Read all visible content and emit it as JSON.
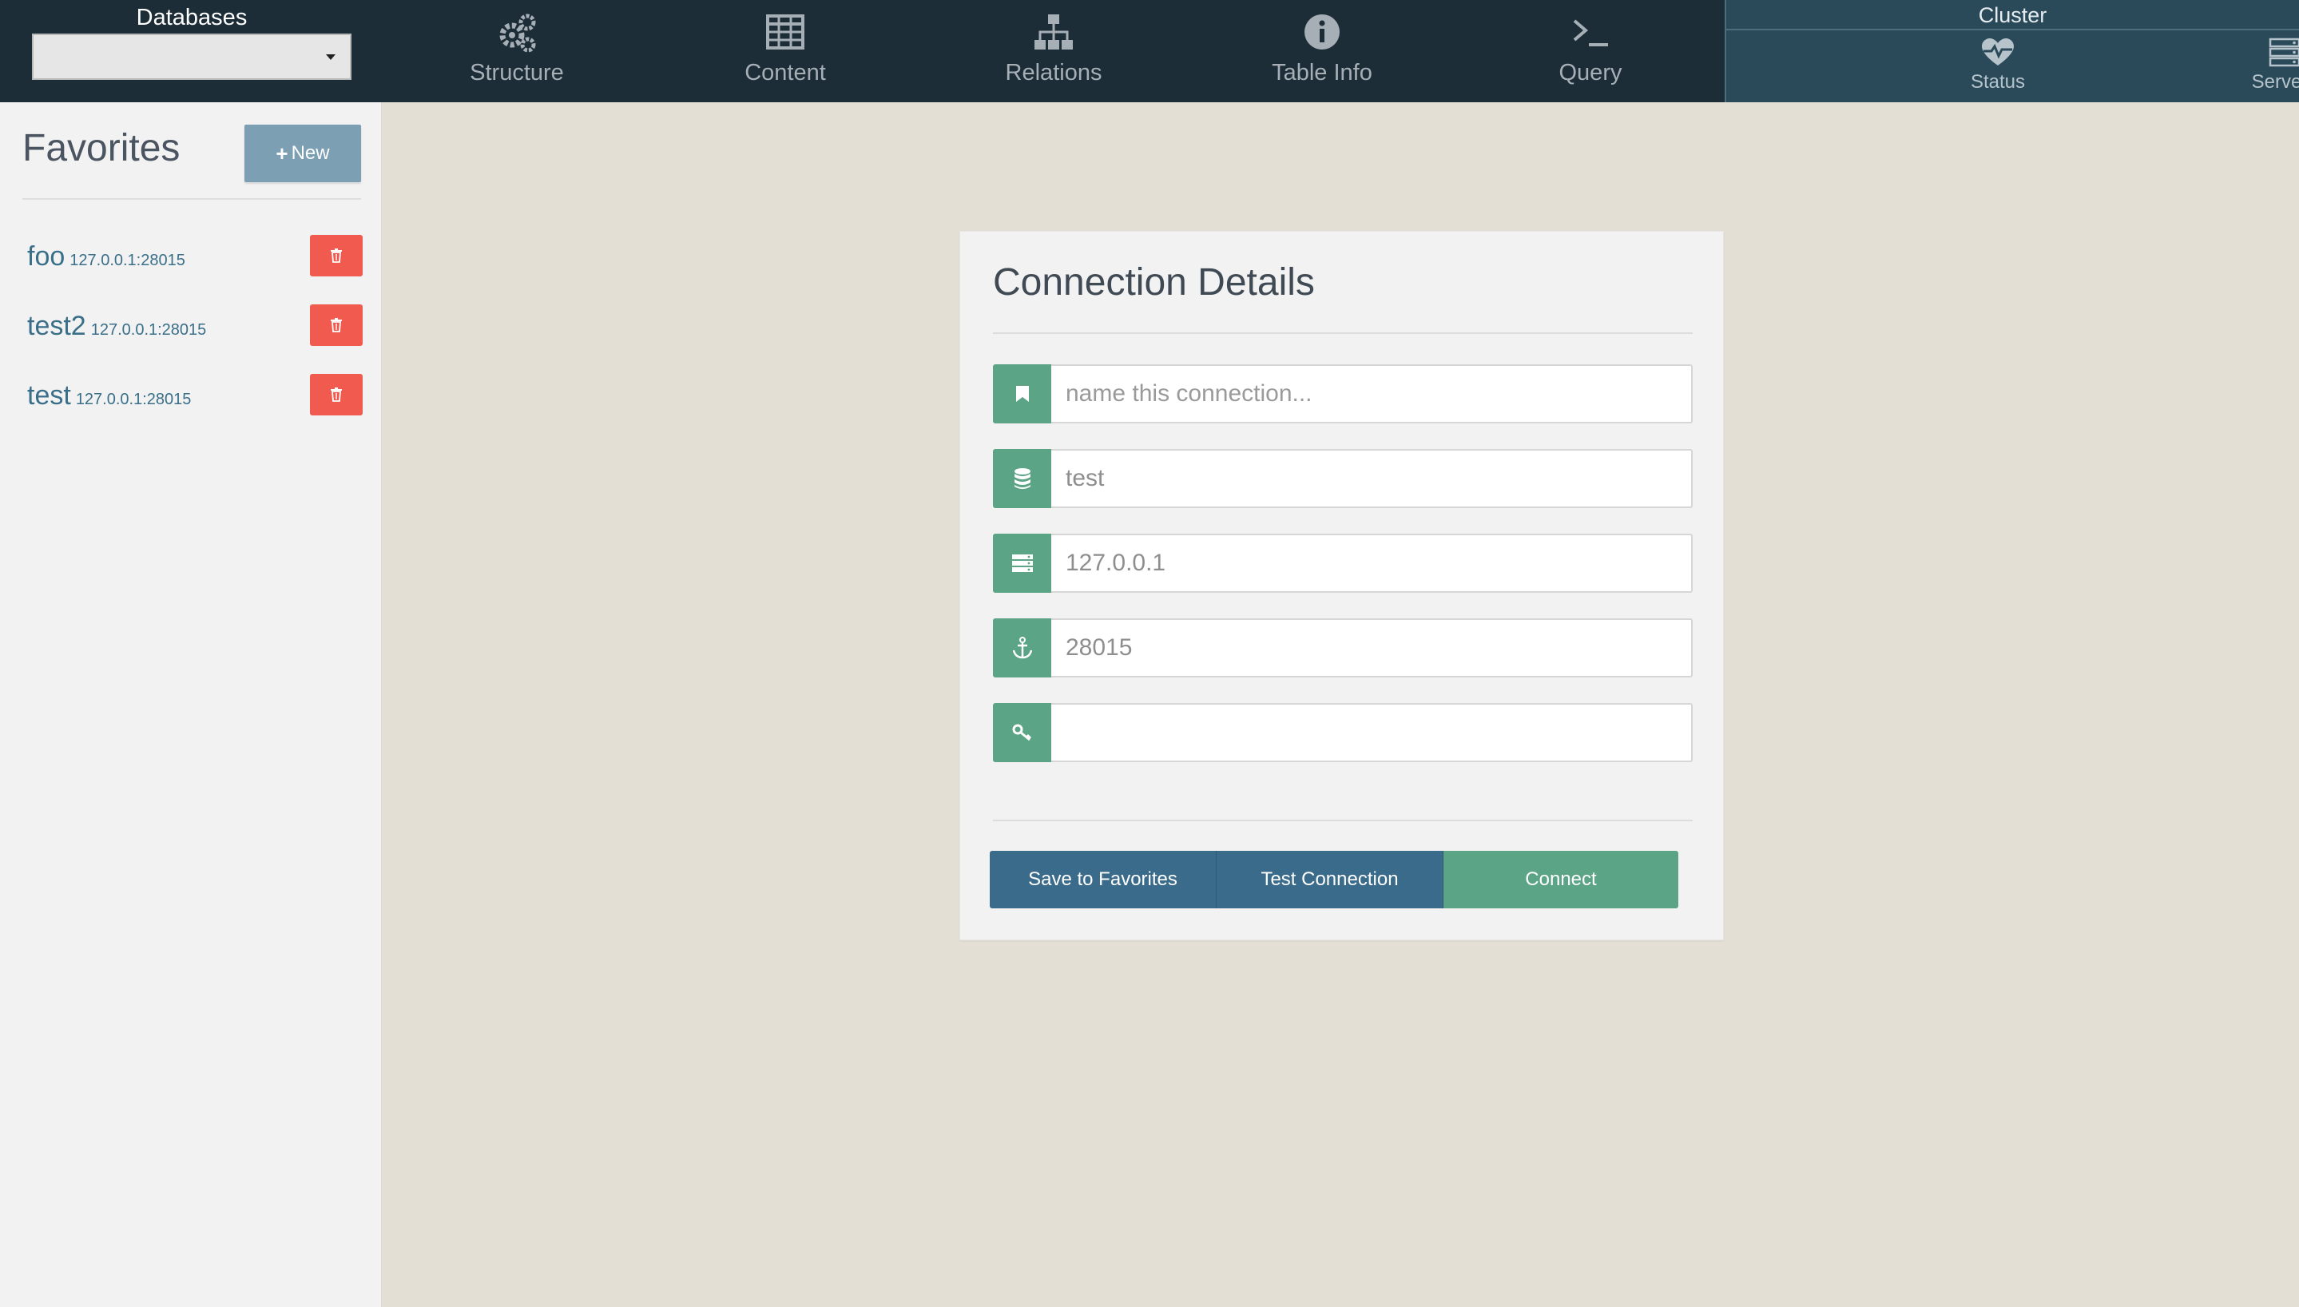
{
  "topbar": {
    "databases_label": "Databases",
    "databases_selected": "",
    "nav": [
      {
        "label": "Structure",
        "icon": "gears-icon"
      },
      {
        "label": "Content",
        "icon": "table-icon"
      },
      {
        "label": "Relations",
        "icon": "sitemap-icon"
      },
      {
        "label": "Table Info",
        "icon": "info-icon"
      },
      {
        "label": "Query",
        "icon": "terminal-icon"
      }
    ],
    "cluster": {
      "title": "Cluster",
      "items": [
        {
          "label": "Status",
          "icon": "heartbeat-icon"
        },
        {
          "label": "Servers",
          "icon": "servers-icon"
        }
      ]
    }
  },
  "sidebar": {
    "title": "Favorites",
    "new_button": "New",
    "favorites": [
      {
        "name": "foo",
        "host": "127.0.0.1:28015"
      },
      {
        "name": "test2",
        "host": "127.0.0.1:28015"
      },
      {
        "name": "test",
        "host": "127.0.0.1:28015"
      }
    ]
  },
  "connection": {
    "title": "Connection Details",
    "fields": [
      {
        "icon": "bookmark-icon",
        "value": "",
        "placeholder": "name this connection..."
      },
      {
        "icon": "database-icon",
        "value": "test",
        "placeholder": ""
      },
      {
        "icon": "server-icon",
        "value": "127.0.0.1",
        "placeholder": ""
      },
      {
        "icon": "anchor-icon",
        "value": "28015",
        "placeholder": ""
      },
      {
        "icon": "key-icon",
        "value": "",
        "placeholder": ""
      }
    ],
    "buttons": {
      "save": "Save to Favorites",
      "test": "Test Connection",
      "connect": "Connect"
    }
  },
  "colors": {
    "topbar": "#1c2d38",
    "cluster": "#2a4a5a",
    "accent_green": "#5ca486",
    "accent_blue": "#3a6b8a",
    "danger": "#f05a4f",
    "new_button": "#7c9fb3",
    "background": "#e3dfd4"
  }
}
